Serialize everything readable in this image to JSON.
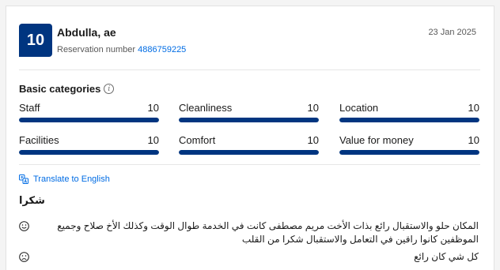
{
  "review": {
    "score": "10",
    "reviewer_name": "Abdulla, ae",
    "reservation_label": "Reservation number",
    "reservation_number": "4886759225",
    "date": "23 Jan 2025"
  },
  "categories": {
    "title": "Basic categories",
    "info_icon": "i",
    "max_score": 10,
    "items": [
      {
        "label": "Staff",
        "score": "10",
        "value": 10
      },
      {
        "label": "Cleanliness",
        "score": "10",
        "value": 10
      },
      {
        "label": "Location",
        "score": "10",
        "value": 10
      },
      {
        "label": "Facilities",
        "score": "10",
        "value": 10
      },
      {
        "label": "Comfort",
        "score": "10",
        "value": 10
      },
      {
        "label": "Value for money",
        "score": "10",
        "value": 10
      }
    ]
  },
  "translate": {
    "label": "Translate to English",
    "icon": "translate-icon"
  },
  "body": {
    "title": "شكرا",
    "positive": "المكان حلو والاستقبال رائع بذات الأخت مريم مصطفى كانت في الخدمة طوال الوقت وكذلك الأخ صلاح وجميع الموظفين كانوا راقين في التعامل والاستقبال شكرا من القلب",
    "negative": "كل شي كان رائع",
    "positive_icon": "smiley-happy-icon",
    "negative_icon": "smiley-sad-icon"
  },
  "colors": {
    "brand": "#003580",
    "link": "#006ce4",
    "bar_track": "#e7e7e7"
  }
}
